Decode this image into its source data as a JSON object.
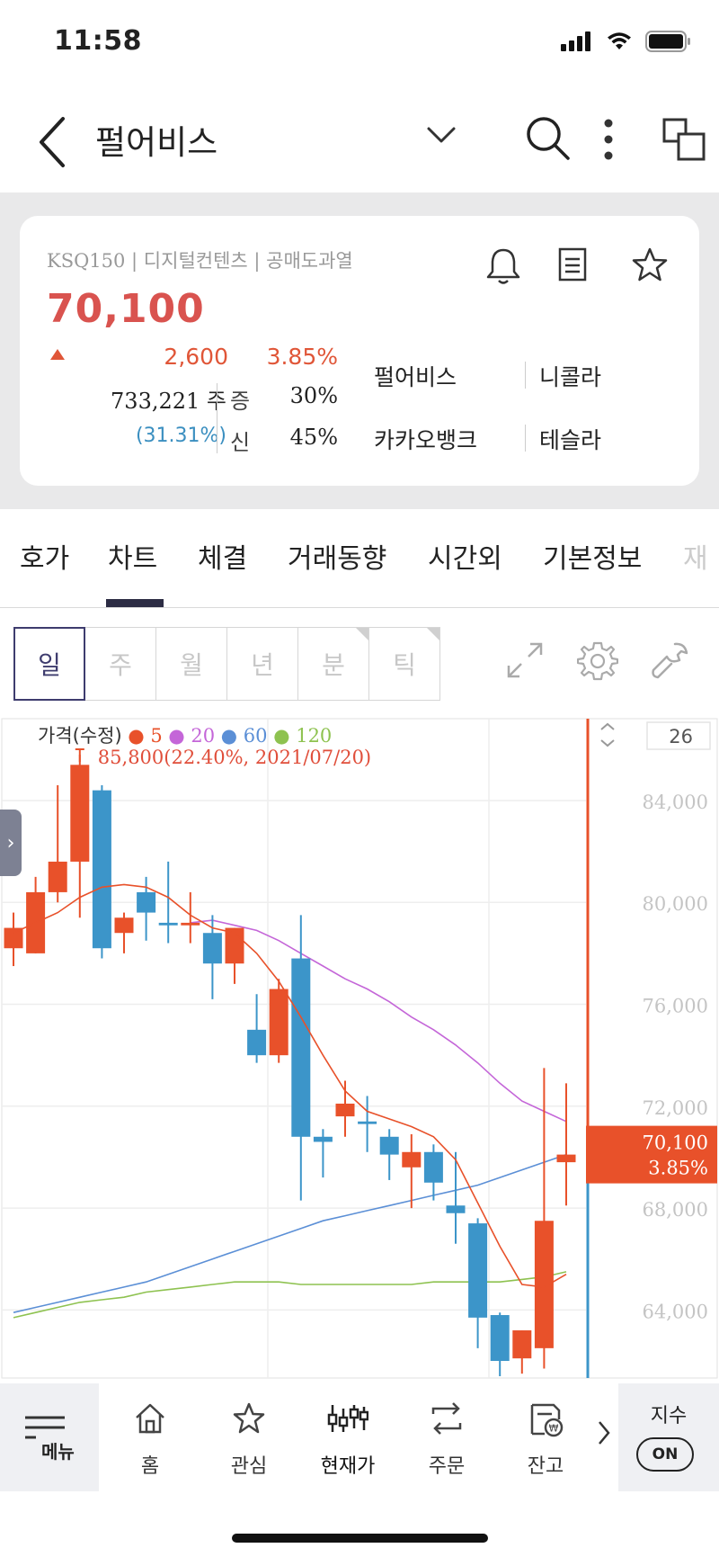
{
  "status": {
    "time": "11:58"
  },
  "header": {
    "title": "펄어비스"
  },
  "stock": {
    "info": "KSQ150 | 디지털컨텐츠 | 공매도과열",
    "price": "70,100",
    "change": "2,600",
    "rate": "3.85%",
    "volume": "733,221 주",
    "volume_rate": "(31.31%)",
    "margin1_label": "증",
    "margin1_value": "30%",
    "margin2_label": "신",
    "margin2_value": "45%",
    "related": [
      "펄어비스",
      "니콜라",
      "카카오뱅크",
      "테슬라"
    ]
  },
  "tabs": [
    "호가",
    "차트",
    "체결",
    "거래동향",
    "시간외",
    "기본정보",
    "재"
  ],
  "periods": [
    "일",
    "주",
    "월",
    "년",
    "분",
    "틱"
  ],
  "chart_data": {
    "type": "candlestick",
    "legend": {
      "title": "가격(수정)",
      "series": [
        {
          "name": "5",
          "color": "#e8512a"
        },
        {
          "name": "20",
          "color": "#c466d8"
        },
        {
          "name": "60",
          "color": "#5b8fd6"
        },
        {
          "name": "120",
          "color": "#8ec250"
        }
      ]
    },
    "count_label": "26",
    "high_annotation": "85,800(22.40%, 2021/07/20)",
    "y_ticks": [
      "84,000",
      "80,000",
      "76,000",
      "72,000",
      "68,000",
      "64,000"
    ],
    "ylim": [
      61400,
      87000
    ],
    "current": {
      "price": "70,100",
      "rate": "3.85%"
    },
    "candles": [
      {
        "o": 78200,
        "h": 79600,
        "l": 77500,
        "c": 79000
      },
      {
        "o": 78000,
        "h": 81000,
        "l": 78000,
        "c": 80400
      },
      {
        "o": 80400,
        "h": 84600,
        "l": 80000,
        "c": 81600
      },
      {
        "o": 81600,
        "h": 85800,
        "l": 79400,
        "c": 85400
      },
      {
        "o": 84400,
        "h": 84600,
        "l": 77800,
        "c": 78200
      },
      {
        "o": 78800,
        "h": 79600,
        "l": 78000,
        "c": 79400
      },
      {
        "o": 80400,
        "h": 81000,
        "l": 78500,
        "c": 79600
      },
      {
        "o": 79200,
        "h": 81600,
        "l": 78400,
        "c": 79100
      },
      {
        "o": 79100,
        "h": 80400,
        "l": 78400,
        "c": 79200
      },
      {
        "o": 78800,
        "h": 79500,
        "l": 76200,
        "c": 77600
      },
      {
        "o": 77600,
        "h": 79000,
        "l": 76800,
        "c": 79000
      },
      {
        "o": 75000,
        "h": 76400,
        "l": 73700,
        "c": 74000
      },
      {
        "o": 74000,
        "h": 77000,
        "l": 73700,
        "c": 76600
      },
      {
        "o": 77800,
        "h": 79500,
        "l": 68300,
        "c": 70800
      },
      {
        "o": 70800,
        "h": 71100,
        "l": 69200,
        "c": 70600
      },
      {
        "o": 71600,
        "h": 73000,
        "l": 70800,
        "c": 72100
      },
      {
        "o": 71400,
        "h": 72400,
        "l": 70200,
        "c": 71300
      },
      {
        "o": 70800,
        "h": 71100,
        "l": 69100,
        "c": 70100
      },
      {
        "o": 69600,
        "h": 70900,
        "l": 68000,
        "c": 70200
      },
      {
        "o": 70200,
        "h": 70500,
        "l": 68300,
        "c": 69000
      },
      {
        "o": 68100,
        "h": 70200,
        "l": 66600,
        "c": 67800
      },
      {
        "o": 67400,
        "h": 67600,
        "l": 62500,
        "c": 63700
      },
      {
        "o": 63800,
        "h": 63900,
        "l": 61400,
        "c": 62000
      },
      {
        "o": 62100,
        "h": 63200,
        "l": 61500,
        "c": 63200
      },
      {
        "o": 62500,
        "h": 73500,
        "l": 61700,
        "c": 67500
      },
      {
        "o": 69800,
        "h": 72900,
        "l": 68100,
        "c": 70100
      }
    ],
    "ma5": [
      78800,
      79200,
      79600,
      80200,
      80600,
      80700,
      80600,
      80200,
      79500,
      79000,
      78800,
      78000,
      76900,
      75500,
      74000,
      72600,
      71800,
      71500,
      71200,
      70800,
      69900,
      68200,
      66500,
      65000,
      64900,
      65400
    ],
    "ma20": [
      null,
      null,
      null,
      null,
      null,
      null,
      null,
      null,
      79200,
      79300,
      79100,
      78900,
      78500,
      78000,
      77500,
      77000,
      76600,
      76100,
      75500,
      75000,
      74400,
      73700,
      72900,
      72200,
      71800,
      71400
    ],
    "ma60": [
      63900,
      64100,
      64300,
      64500,
      64700,
      64900,
      65100,
      65400,
      65700,
      66000,
      66300,
      66600,
      66900,
      67200,
      67500,
      67700,
      67900,
      68100,
      68300,
      68500,
      68700,
      68900,
      69200,
      69500,
      69800,
      70100
    ],
    "ma120": [
      63700,
      63900,
      64100,
      64300,
      64400,
      64500,
      64700,
      64800,
      64900,
      65000,
      65100,
      65100,
      65100,
      65000,
      65000,
      65000,
      65000,
      65000,
      65000,
      65100,
      65100,
      65100,
      65100,
      65200,
      65300,
      65500
    ]
  },
  "bottom_nav": {
    "menu": "메뉴",
    "items": [
      "홈",
      "관심",
      "현재가",
      "주문",
      "잔고"
    ],
    "index_label": "지수",
    "index_toggle": "ON"
  }
}
